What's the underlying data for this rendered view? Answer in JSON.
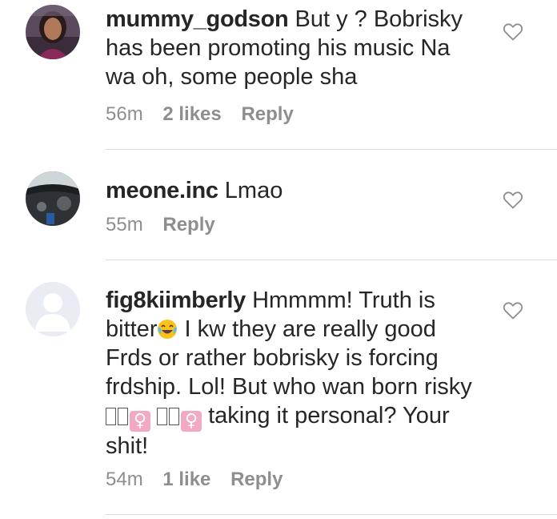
{
  "comments": [
    {
      "username": "mummy_godson",
      "text": "But y ? Bobrisky has been promoting his music Na wa oh, some people sha",
      "time": "56m",
      "likes": "2 likes",
      "reply": "Reply",
      "avatar_icon": "user-photo-woman"
    },
    {
      "username": "meone.inc",
      "text": "Lmao",
      "time": "55m",
      "likes": "",
      "reply": "Reply",
      "avatar_icon": "user-photo-car-interior"
    },
    {
      "username": "fig8kiimberly",
      "text_part1": "Hmmmm! Truth is bitter",
      "emoji": "face-with-tears-of-joy-emoji",
      "text_part2": " I kw they are really good Frds or rather bobrisky is forcing frdship. Lol! But who wan born risky",
      "gender_symbol": "♀",
      "text_part3": " taking it personal? Your shit!",
      "time": "54m",
      "likes": "1 like",
      "reply": "Reply",
      "avatar_icon": "default-avatar-icon"
    }
  ],
  "colors": {
    "text": "#262626",
    "meta": "#8e8e8e",
    "divider": "#dbdbdb",
    "default_avatar_bg": "#e9ecf3"
  }
}
